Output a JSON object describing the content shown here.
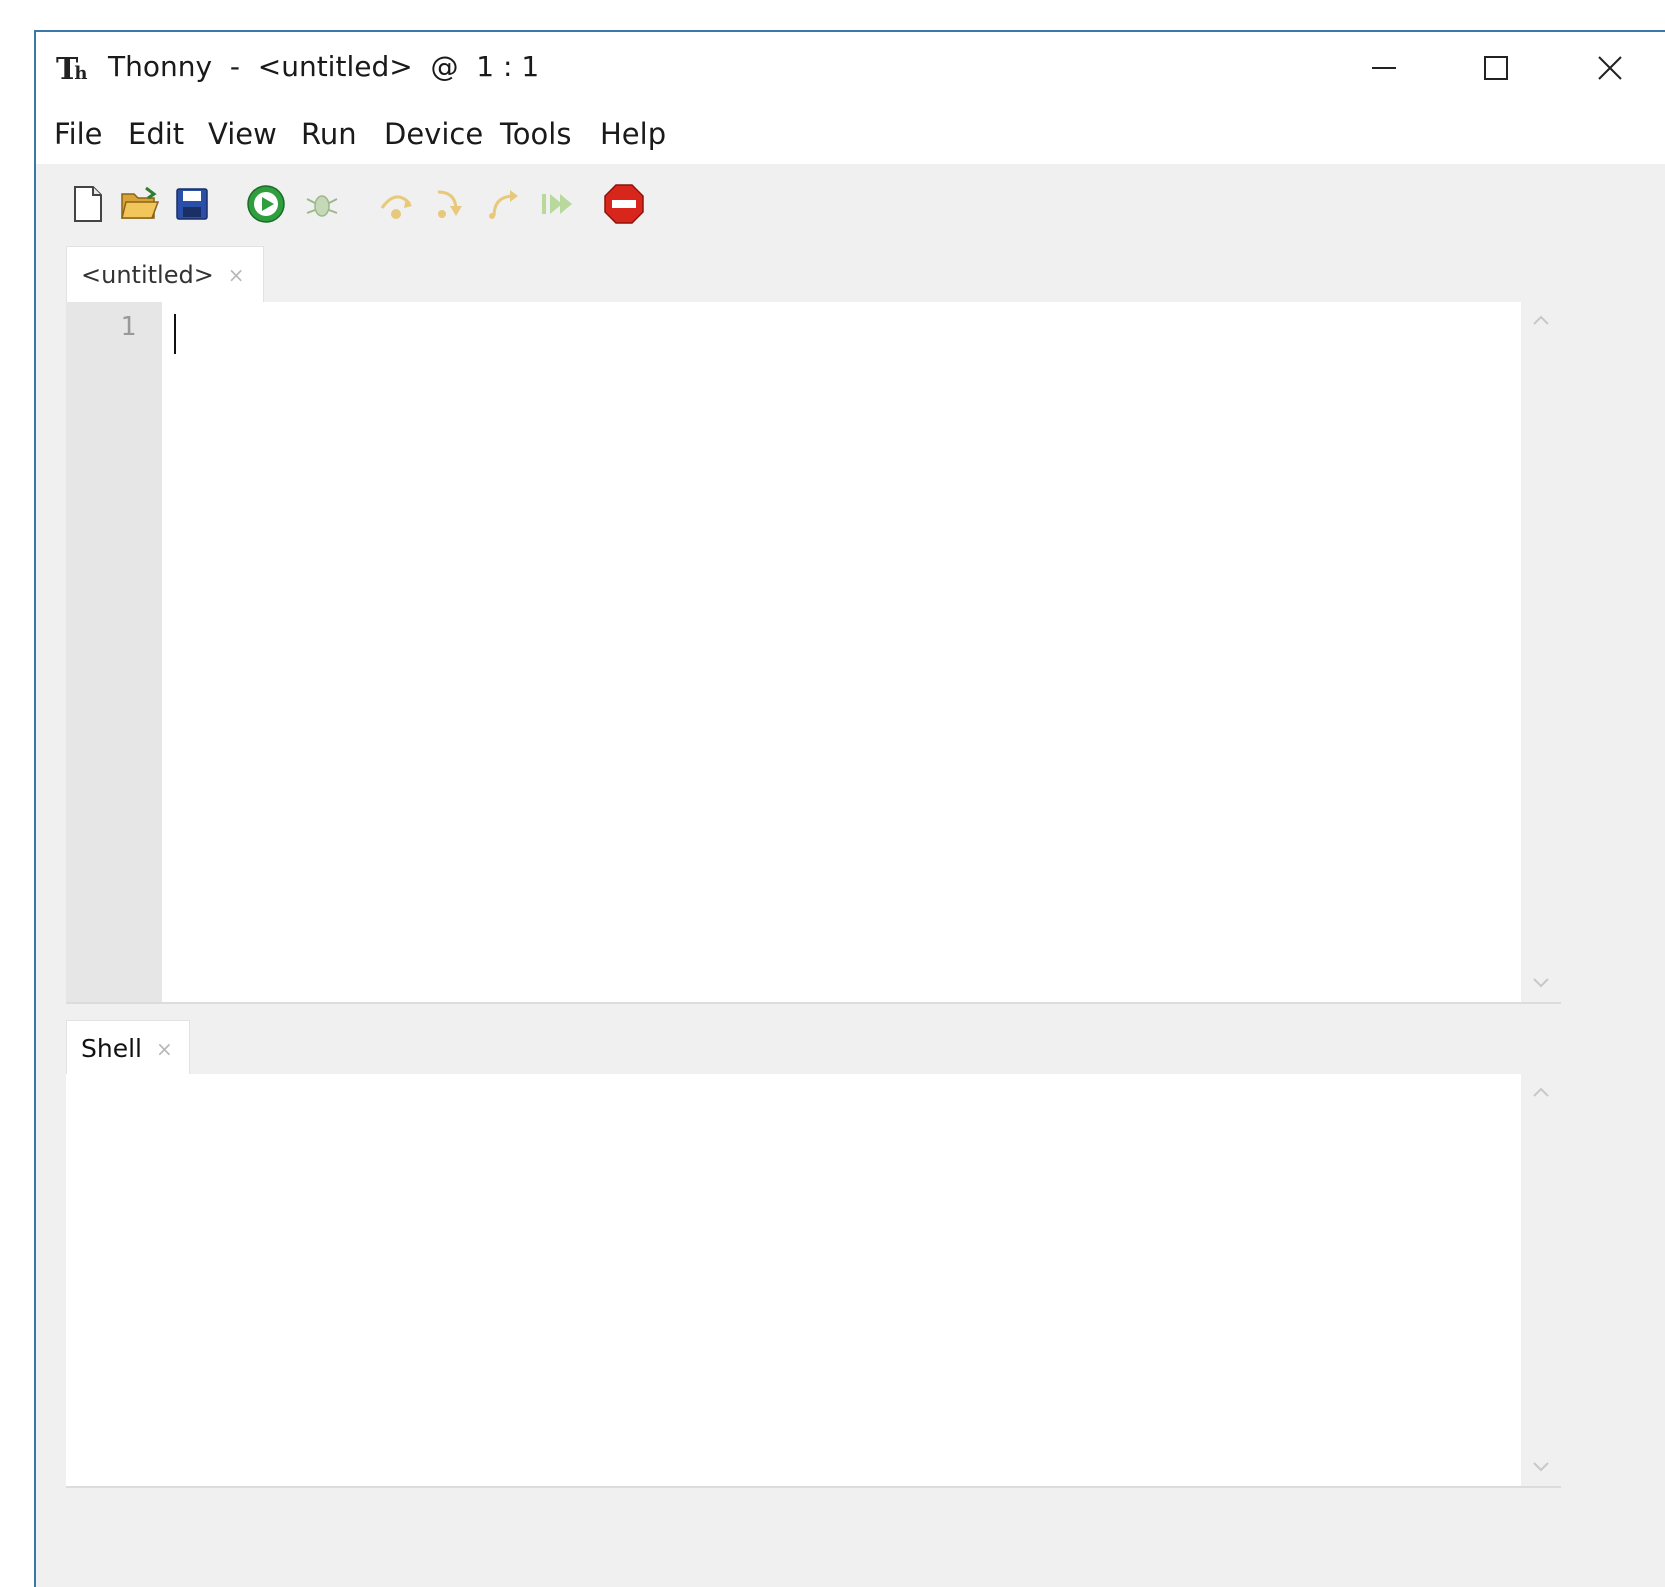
{
  "window": {
    "title": "Thonny  -  <untitled>  @  1 : 1",
    "logo_main": "T",
    "logo_sub": "h"
  },
  "menubar": {
    "items": [
      "File",
      "Edit",
      "View",
      "Run",
      "Device",
      "Tools",
      "Help"
    ]
  },
  "toolbar": {
    "icons": [
      "new-file-icon",
      "open-file-icon",
      "save-icon",
      "run-icon",
      "debug-icon",
      "step-over-icon",
      "step-into-icon",
      "step-out-icon",
      "resume-icon",
      "stop-icon"
    ]
  },
  "editor": {
    "tab_label": "<untitled>",
    "tab_close": "×",
    "line_numbers": [
      "1"
    ]
  },
  "shell": {
    "tab_label": "Shell",
    "tab_close": "×"
  },
  "colors": {
    "accent_border": "#3a78a8",
    "run_green": "#2e9e3e",
    "stop_red": "#d9261c"
  }
}
